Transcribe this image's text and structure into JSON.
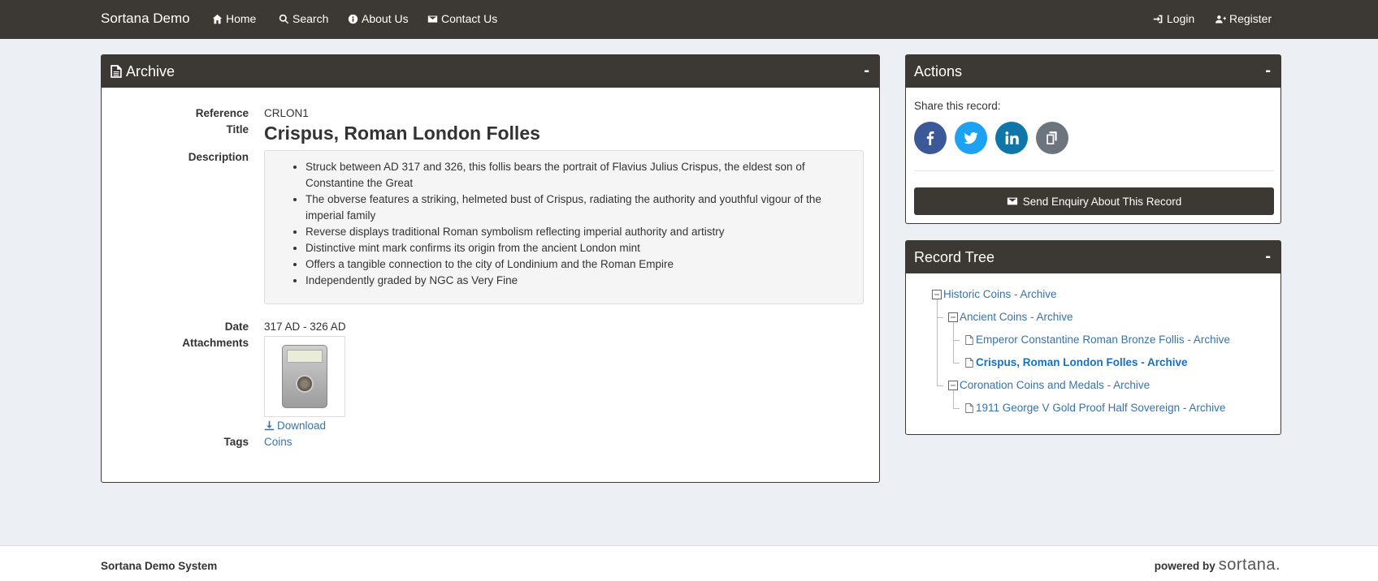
{
  "navbar": {
    "brand": "Sortana Demo",
    "home": "Home",
    "search": "Search",
    "about": "About Us",
    "contact": "Contact Us",
    "login": "Login",
    "register": "Register"
  },
  "archive": {
    "panel_title": "Archive",
    "collapse": "-",
    "labels": {
      "reference": "Reference",
      "title": "Title",
      "description": "Description",
      "date": "Date",
      "attachments": "Attachments",
      "tags": "Tags"
    },
    "reference": "CRLON1",
    "title": "Crispus, Roman London Folles",
    "description": [
      "Struck between AD 317 and 326, this follis bears the portrait of Flavius Julius Crispus, the eldest son of Constantine the Great",
      "The obverse features a striking, helmeted bust of Crispus, radiating the authority and youthful vigour of the imperial family",
      "Reverse displays traditional Roman symbolism reflecting imperial authority and artistry",
      "Distinctive mint mark confirms its origin from the ancient London mint",
      "Offers a tangible connection to the city of Londinium and the Roman Empire",
      "Independently graded by NGC as Very Fine"
    ],
    "date": "317 AD - 326 AD",
    "download": "Download",
    "tag": "Coins"
  },
  "actions": {
    "panel_title": "Actions",
    "collapse": "-",
    "share_label": "Share this record:",
    "enquiry_button": "Send Enquiry About This Record"
  },
  "record_tree": {
    "panel_title": "Record Tree",
    "collapse": "-",
    "items": [
      "Historic Coins - Archive",
      "Ancient Coins - Archive",
      "Emperor Constantine Roman Bronze Follis - Archive",
      "Crispus, Roman London Folles - Archive",
      "Coronation Coins and Medals - Archive",
      "1911 George V Gold Proof Half Sovereign - Archive"
    ]
  },
  "footer": {
    "left": "Sortana Demo System",
    "powered_by": "powered by",
    "logo": "sortana."
  },
  "colors": {
    "header": "#3c3833",
    "link": "#3a73a8",
    "facebook": "#3b5998",
    "twitter": "#1da1f2",
    "linkedin": "#0e76a8",
    "copy": "#6c757d"
  }
}
